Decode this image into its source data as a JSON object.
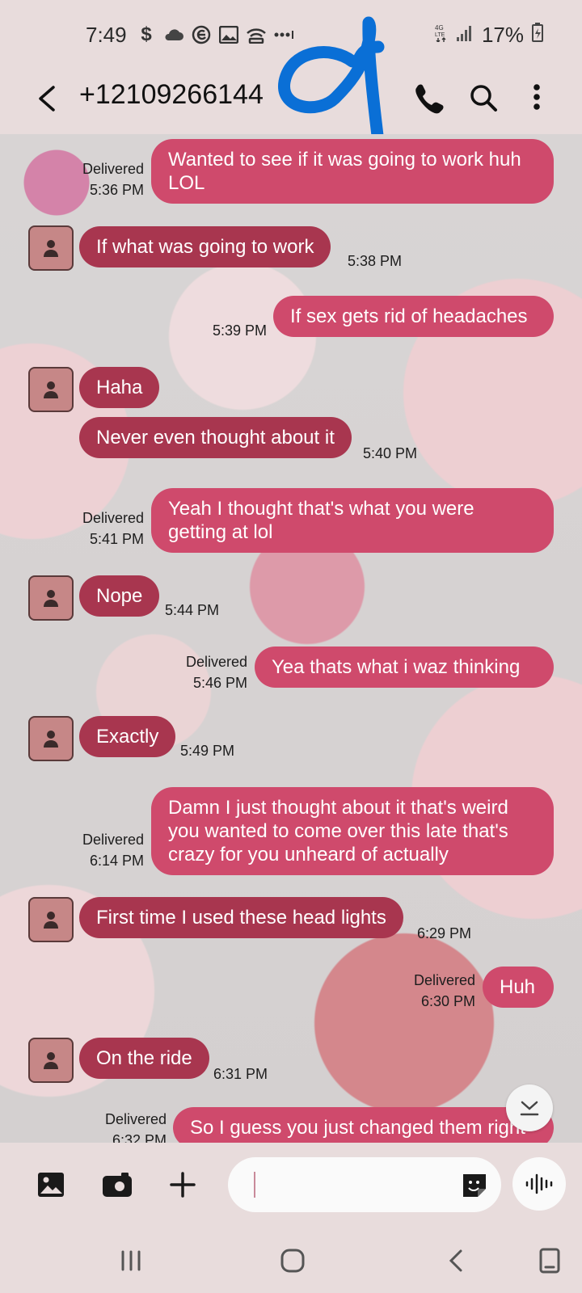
{
  "status_bar": {
    "time": "7:49",
    "battery": "17%",
    "icons": [
      "dollar-icon",
      "cloud-icon",
      "e-app-icon",
      "gallery-icon",
      "hotspot-icon",
      "more-dots-icon"
    ],
    "right_icons": [
      "4g-lte-icon",
      "signal-icon",
      "battery-icon"
    ]
  },
  "header": {
    "title": "+12109266144",
    "icons": [
      "back-icon",
      "phone-icon",
      "search-icon",
      "more-vert-icon"
    ]
  },
  "colors": {
    "sent_bubble": "#cf4a6c",
    "received_bubble": "#a8364f",
    "background": "#e8dcdc"
  },
  "messages": [
    {
      "dir": "sent",
      "text_lines": [
        "Wanted to see if it was going to work huh",
        "LOL"
      ],
      "status": "Delivered",
      "time": "5:36 PM"
    },
    {
      "dir": "received",
      "text": "If what was going to work",
      "time": "5:38 PM"
    },
    {
      "dir": "sent",
      "text": "If sex gets rid of headaches",
      "time": "5:39 PM"
    },
    {
      "dir": "received",
      "text": "Haha"
    },
    {
      "dir": "received",
      "text": "Never even thought about it",
      "time": "5:40 PM"
    },
    {
      "dir": "sent",
      "text_lines": [
        "Yeah I thought that's what you were",
        "getting at lol"
      ],
      "status": "Delivered",
      "time": "5:41 PM"
    },
    {
      "dir": "received",
      "text": "Nope",
      "time": "5:44 PM"
    },
    {
      "dir": "sent",
      "text": "Yea thats what i waz thinking",
      "status": "Delivered",
      "time": "5:46 PM"
    },
    {
      "dir": "received",
      "text": "Exactly",
      "time": "5:49 PM"
    },
    {
      "dir": "sent",
      "text_lines": [
        "Damn I just thought about it that's weird",
        "you wanted to come over this late that's",
        "crazy for you unheard of actually"
      ],
      "status": "Delivered",
      "time": "6:14 PM"
    },
    {
      "dir": "received",
      "text": "First time I used these head lights",
      "time": "6:29 PM"
    },
    {
      "dir": "sent",
      "text": "Huh",
      "status": "Delivered",
      "time": "6:30 PM"
    },
    {
      "dir": "received",
      "text": "On the ride",
      "time": "6:31 PM"
    },
    {
      "dir": "sent",
      "text": "So I guess you just changed them right",
      "status": "Delivered",
      "time": "6:32 PM"
    }
  ],
  "composer": {
    "placeholder": "",
    "icons": [
      "gallery-icon",
      "camera-icon",
      "plus-icon",
      "sticker-icon",
      "voice-icon"
    ]
  },
  "nav": {
    "icons": [
      "recent-apps-icon",
      "home-icon",
      "back-icon",
      "keyboard-icon"
    ]
  }
}
